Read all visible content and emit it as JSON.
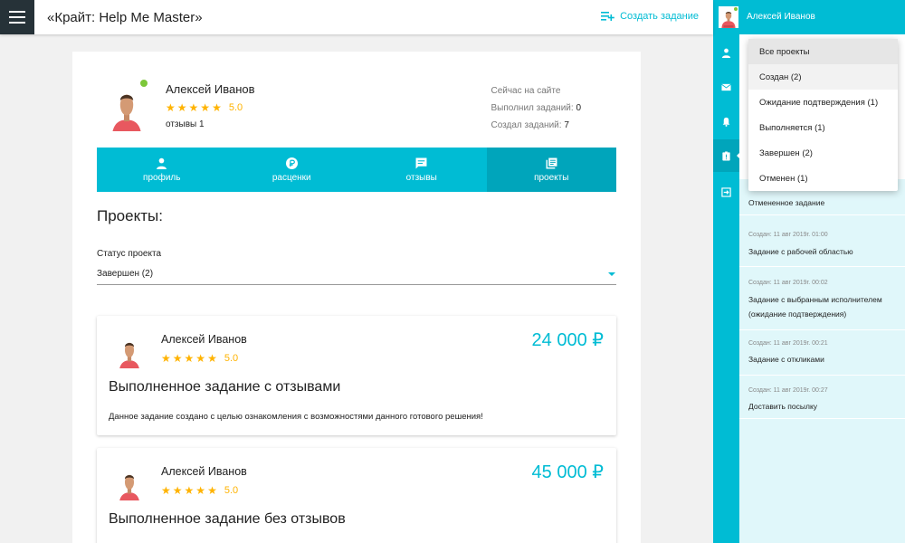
{
  "header": {
    "title": "«Крайт: Help Me Master»",
    "create_task_label": "Создать задание"
  },
  "profile": {
    "name": "Алексей Иванов",
    "rating": "5.0",
    "reviews": "отзывы 1",
    "online_label": "Сейчас на сайте",
    "completed_label": "Выполнил заданий:",
    "completed_value": "0",
    "created_label": "Создал заданий:",
    "created_value": "7"
  },
  "tabs": [
    {
      "label": "профиль",
      "icon": "person-icon"
    },
    {
      "label": "расценки",
      "icon": "ruble-icon"
    },
    {
      "label": "отзывы",
      "icon": "comment-icon"
    },
    {
      "label": "проекты",
      "icon": "library-icon",
      "active": true
    }
  ],
  "projects": {
    "title": "Проекты:",
    "status_label": "Статус проекта",
    "status_value": "Завершен (2)",
    "cards": [
      {
        "name": "Алексей Иванов",
        "rating": "5.0",
        "price": "24 000 ₽",
        "title": "Выполненное задание с отзывами",
        "description": "Данное задание создано с целью ознакомления с возможностями данного готового решения!"
      },
      {
        "name": "Алексей Иванов",
        "rating": "5.0",
        "price": "45 000 ₽",
        "title": "Выполненное задание без отзывов",
        "description": ""
      }
    ]
  },
  "side": {
    "user_name": "Алексей Иванов",
    "rail_icons": [
      "person-icon",
      "mail-icon",
      "bell-icon",
      "assignment-icon",
      "exit-icon"
    ],
    "dropdown_options": [
      "Все проекты",
      "Создан (2)",
      "Ожидание подтверждения (1)",
      "Выполняется (1)",
      "Завершен (2)",
      "Отменен (1)"
    ],
    "tasks": [
      {
        "date": "",
        "title": "Отмененное задание"
      },
      {
        "date": "Создан: 11 авг 2019г. 01:00",
        "title": "Задание с рабочей областью"
      },
      {
        "date": "Создан: 11 авг 2019г. 00:02",
        "title": "Задание с выбранным исполнителем (ожидание подтверждения)"
      },
      {
        "date": "Создан: 11 авг 2019г. 00:21",
        "title": "Задание с откликами"
      },
      {
        "date": "Создан: 11 авг 2019г. 00:27",
        "title": "Доставить посылку"
      }
    ]
  },
  "colors": {
    "accent": "#00bcd4",
    "accent_dark": "#00a5bb",
    "star": "#ffb300",
    "online": "#7cc73a"
  }
}
